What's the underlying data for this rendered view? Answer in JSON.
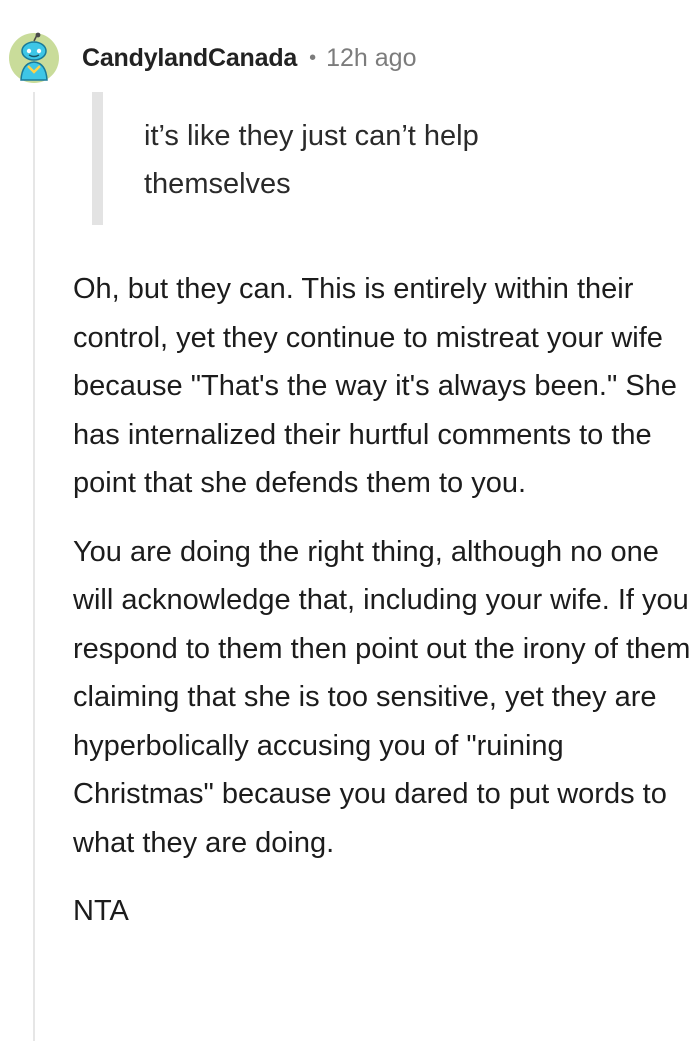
{
  "comment": {
    "avatar_icon": "snoo-avatar-icon",
    "username": "CandylandCanada",
    "separator": "•",
    "timestamp": "12h ago",
    "quote": "it’s like they just can’t help themselves",
    "paragraphs": [
      "Oh, but they can. This is entirely within their control, yet they continue to mistreat your wife because \"That's the way it's always been.\" She has internalized their hurtful comments to the point that she defends them to you.",
      "You are doing the right thing, although no one will acknowledge that, including your wife. If you respond to them then point out the irony of them claiming that she is too sensitive, yet they are hyperbolically accusing you of \"ruining Christmas\" because you dared to put words to what they are doing.",
      "NTA"
    ]
  },
  "colors": {
    "avatar_bg": "#c9dc9a",
    "avatar_body": "#3ec6e6",
    "meta_gray": "#7c7c7c",
    "quote_bar": "#e3e3e3"
  }
}
